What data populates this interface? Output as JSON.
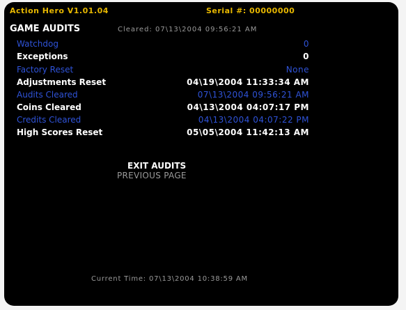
{
  "header": {
    "title": "Action Hero V1.01.04",
    "serial": "Serial #: 00000000"
  },
  "audits": {
    "heading": "GAME AUDITS",
    "cleared": "Cleared: 07\\13\\2004 09:56:21 AM"
  },
  "rows": [
    {
      "label": "Watchdog",
      "value": "0"
    },
    {
      "label": "Exceptions",
      "value": "0"
    },
    {
      "label": "Factory Reset",
      "value": "None"
    },
    {
      "label": "Adjustments Reset",
      "value": "04\\19\\2004 11:33:34 AM"
    },
    {
      "label": "Audits Cleared",
      "value": "07\\13\\2004 09:56:21 AM"
    },
    {
      "label": "Coins Cleared",
      "value": "04\\13\\2004 04:07:17 PM"
    },
    {
      "label": "Credits Cleared",
      "value": "04\\13\\2004 04:07:22 PM"
    },
    {
      "label": "High Scores Reset",
      "value": "05\\05\\2004 11:42:13 AM"
    }
  ],
  "menu": {
    "exit": "EXIT AUDITS",
    "previous": "PREVIOUS PAGE"
  },
  "footer": {
    "current_time": "Current Time: 07\\13\\2004 10:38:59 AM"
  },
  "colors": {
    "header_yellow": "#e8b800",
    "highlight_blue": "#2f53d8",
    "text_white": "#ffffff",
    "text_grey": "#9a9a9a"
  }
}
